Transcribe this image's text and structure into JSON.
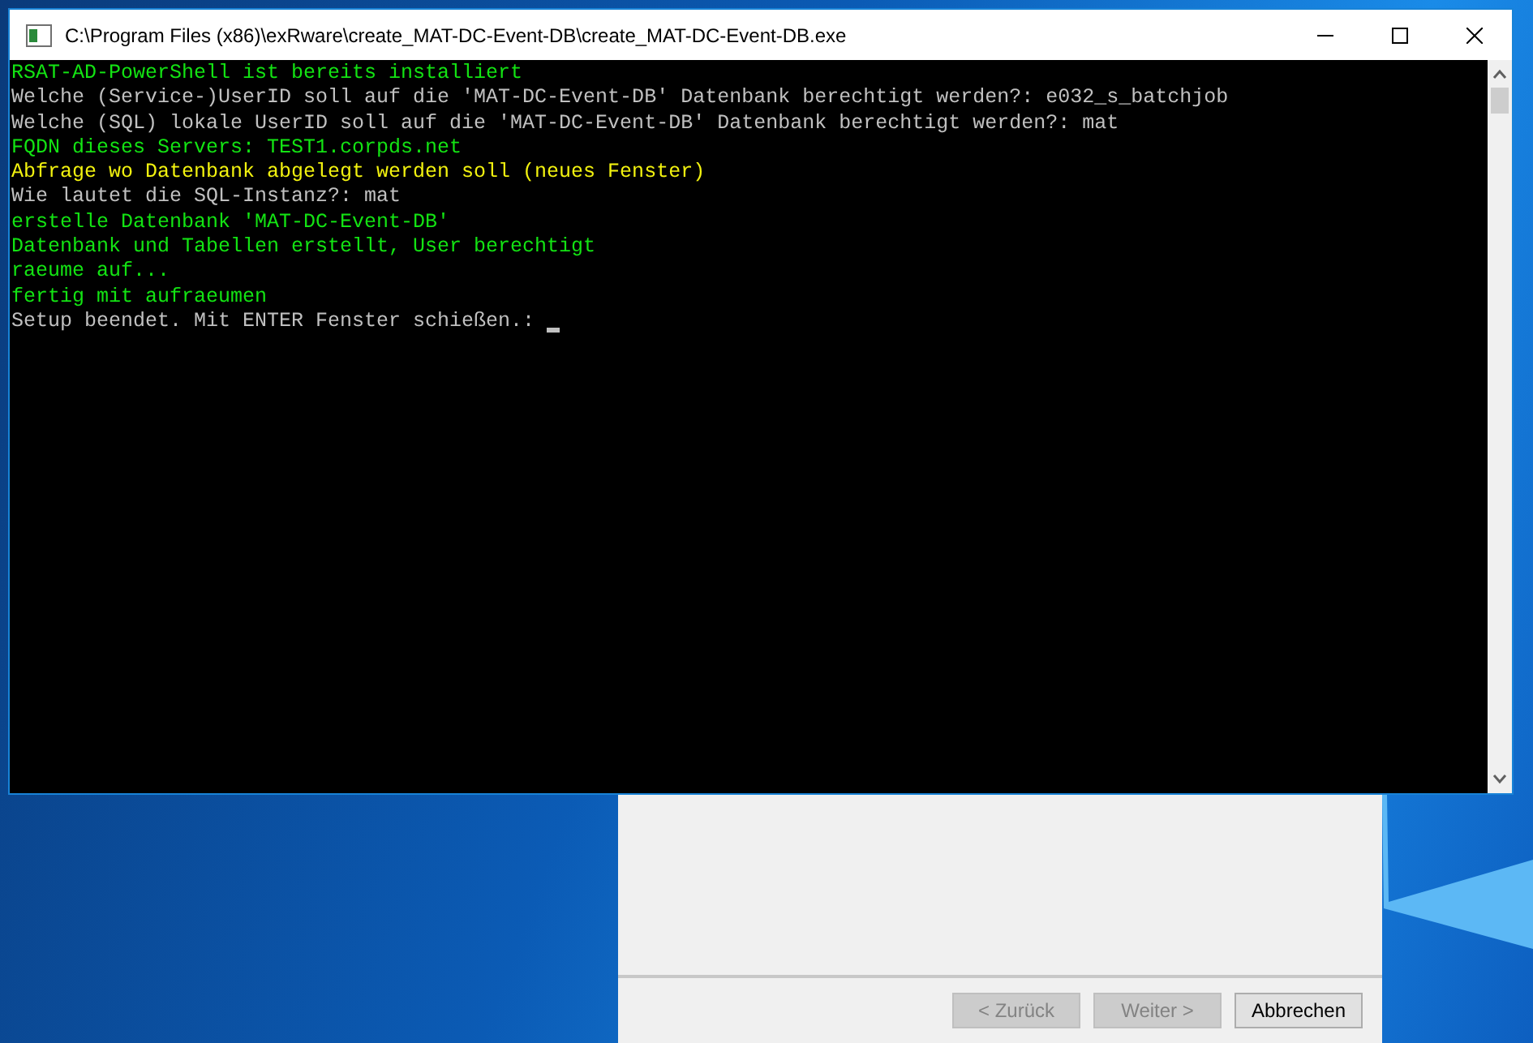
{
  "console_window": {
    "title": "C:\\Program Files (x86)\\exRware\\create_MAT-DC-Event-DB\\create_MAT-DC-Event-DB.exe",
    "lines": [
      {
        "text": "RSAT-AD-PowerShell ist bereits installiert",
        "color": "#13e313"
      },
      {
        "text": "Welche (Service-)UserID soll auf die 'MAT-DC-Event-DB' Datenbank berechtigt werden?: e032_s_batchjob",
        "color": "#c0c0c0"
      },
      {
        "text": "Welche (SQL) lokale UserID soll auf die 'MAT-DC-Event-DB' Datenbank berechtigt werden?: mat",
        "color": "#c0c0c0"
      },
      {
        "text": "FQDN dieses Servers: TEST1.corpds.net",
        "color": "#13e313"
      },
      {
        "text": "Abfrage wo Datenbank abgelegt werden soll (neues Fenster)",
        "color": "#f2f20f"
      },
      {
        "text": "Wie lautet die SQL-Instanz?: mat",
        "color": "#c0c0c0"
      },
      {
        "text": "erstelle Datenbank 'MAT-DC-Event-DB'",
        "color": "#13e313"
      },
      {
        "text": "Datenbank und Tabellen erstellt, User berechtigt",
        "color": "#13e313"
      },
      {
        "text": "raeume auf...",
        "color": "#13e313"
      },
      {
        "text": "fertig mit aufraeumen",
        "color": "#13e313"
      },
      {
        "text": "Setup beendet. Mit ENTER Fenster schießen.: ",
        "color": "#c0c0c0"
      }
    ]
  },
  "wizard_window": {
    "buttons": [
      {
        "label": "< Zurück",
        "disabled": true
      },
      {
        "label": "Weiter >",
        "disabled": true
      },
      {
        "label": "Abbrechen",
        "disabled": false
      }
    ]
  }
}
